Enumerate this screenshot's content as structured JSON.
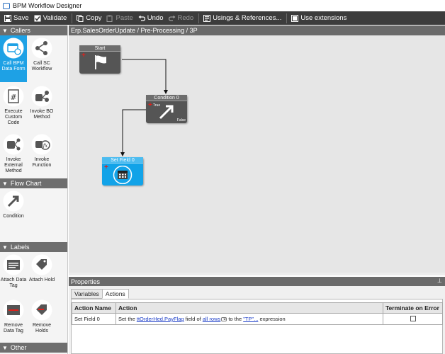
{
  "window": {
    "title": "BPM Workflow Designer"
  },
  "toolbar": {
    "save": "Save",
    "validate": "Validate",
    "copy": "Copy",
    "paste": "Paste",
    "undo": "Undo",
    "redo": "Redo",
    "usings": "Usings & References...",
    "extensions": "Use extensions"
  },
  "sidebar": {
    "callers": {
      "title": "Callers",
      "items": [
        "Call BPM Data Form",
        "Call SC Workflow",
        "Execute Custom Code",
        "Invoke BO Method",
        "Invoke External Method",
        "Invoke Function"
      ]
    },
    "flowchart": {
      "title": "Flow Chart",
      "items": [
        "Condition"
      ]
    },
    "labels": {
      "title": "Labels",
      "items": [
        "Attach Data Tag",
        "Attach Hold",
        "Remove Data Tag",
        "Remove Holds"
      ]
    },
    "other": {
      "title": "Other"
    }
  },
  "canvas": {
    "path": "Erp.SalesOrderUpdate / Pre-Processing / 3P",
    "nodes": {
      "start": "Start",
      "condition": "Condition 0",
      "condition_true": "True",
      "condition_false": "False",
      "setfield": "Set Field 0"
    }
  },
  "properties": {
    "title": "Properties",
    "tabs": [
      "Variables",
      "Actions"
    ],
    "active_tab": "Actions",
    "columns": [
      "Action Name",
      "Action",
      "Terminate on Error"
    ],
    "rows": [
      {
        "name": "Set Field 0",
        "t1": "Set the ",
        "field": "ttOrderHed.PayFlag",
        "t2": " field of ",
        "rows_link": "all rows",
        "t3": " to the ",
        "expr": "\"TP\"...",
        "t4": " expression",
        "terminate": false
      }
    ]
  }
}
